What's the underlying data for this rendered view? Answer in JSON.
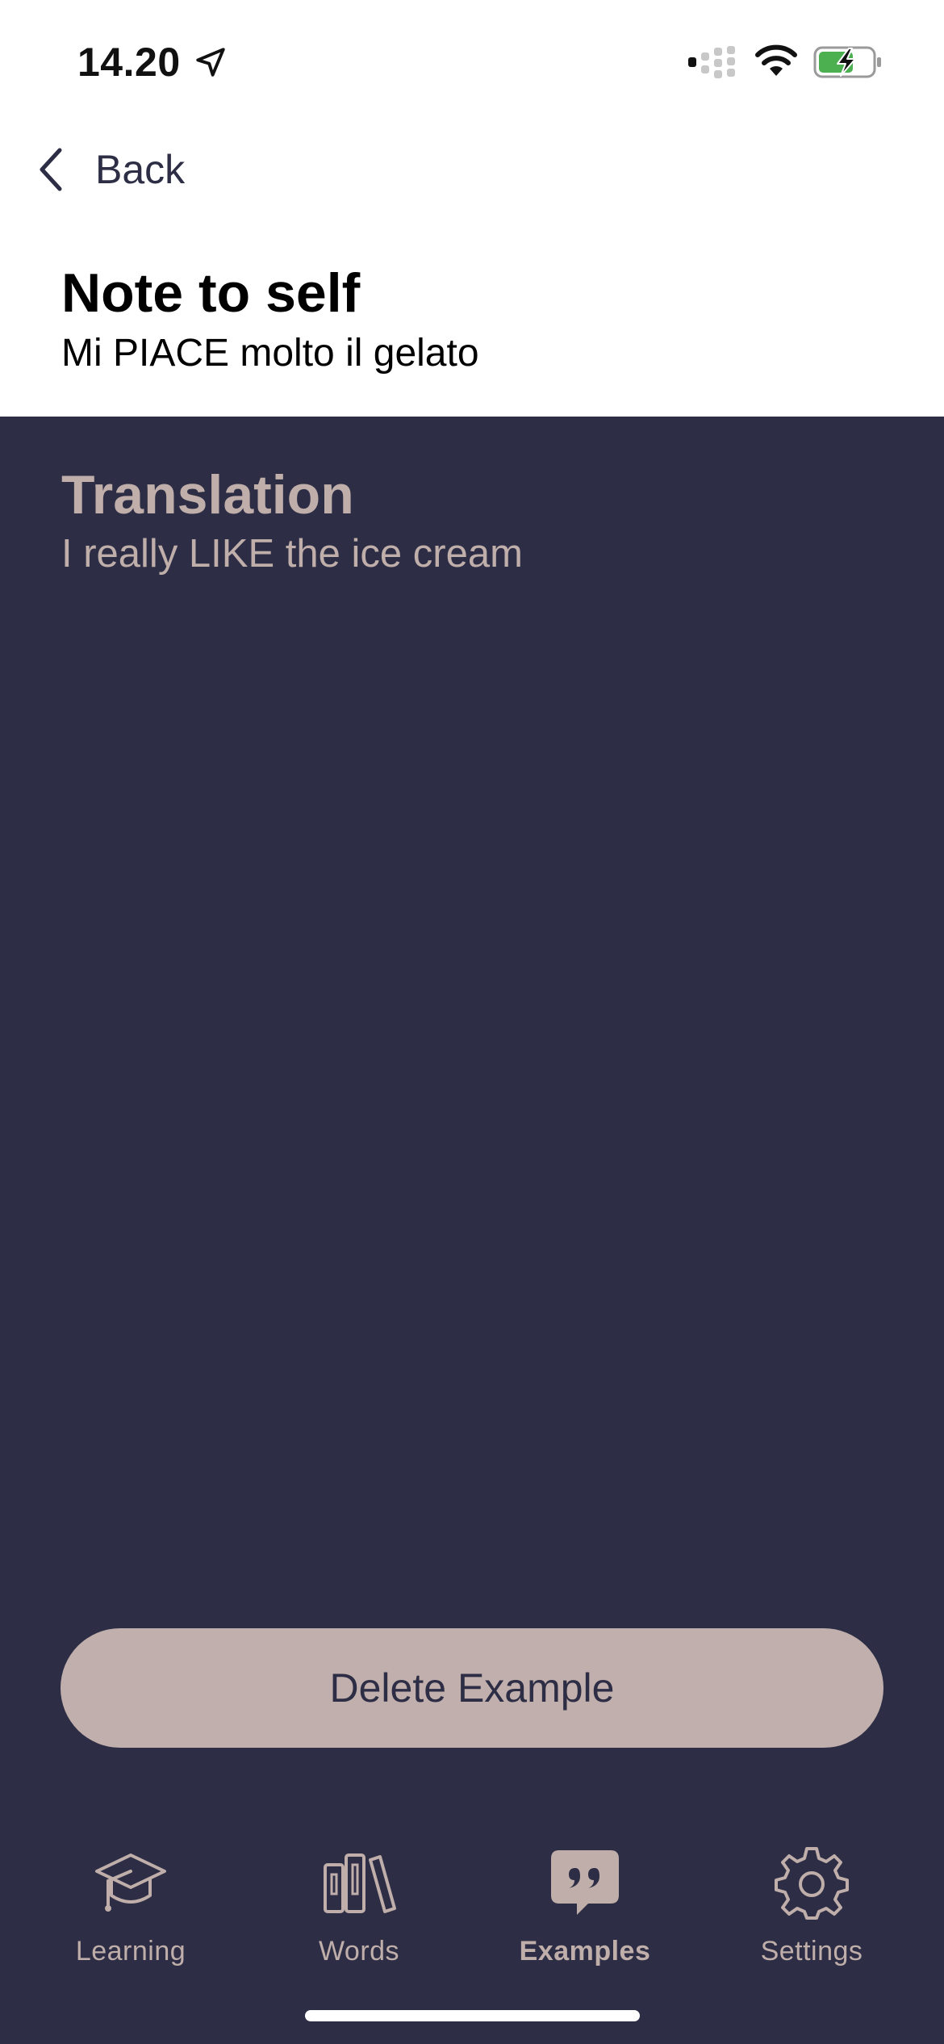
{
  "status_bar": {
    "time": "14.20",
    "icons": [
      "location-arrow-icon",
      "cellular-signal-icon",
      "wifi-icon",
      "battery-charging-icon"
    ],
    "battery_color": "#4caf50"
  },
  "nav": {
    "back_label": "Back"
  },
  "note": {
    "title": "Note to self",
    "text": "Mi PIACE molto il gelato"
  },
  "translation": {
    "title": "Translation",
    "text": "I really LIKE the ice cream"
  },
  "actions": {
    "delete_label": "Delete Example"
  },
  "tab_bar": {
    "items": [
      {
        "label": "Learning",
        "icon": "graduation-cap-icon",
        "active": false
      },
      {
        "label": "Words",
        "icon": "books-icon",
        "active": false
      },
      {
        "label": "Examples",
        "icon": "quote-bubble-icon",
        "active": true
      },
      {
        "label": "Settings",
        "icon": "gear-icon",
        "active": false
      }
    ]
  },
  "colors": {
    "background_dark": "#2d2e45",
    "accent": "#bfaeaa",
    "button_bg": "#c0afac",
    "top_bg": "#ffffff"
  }
}
